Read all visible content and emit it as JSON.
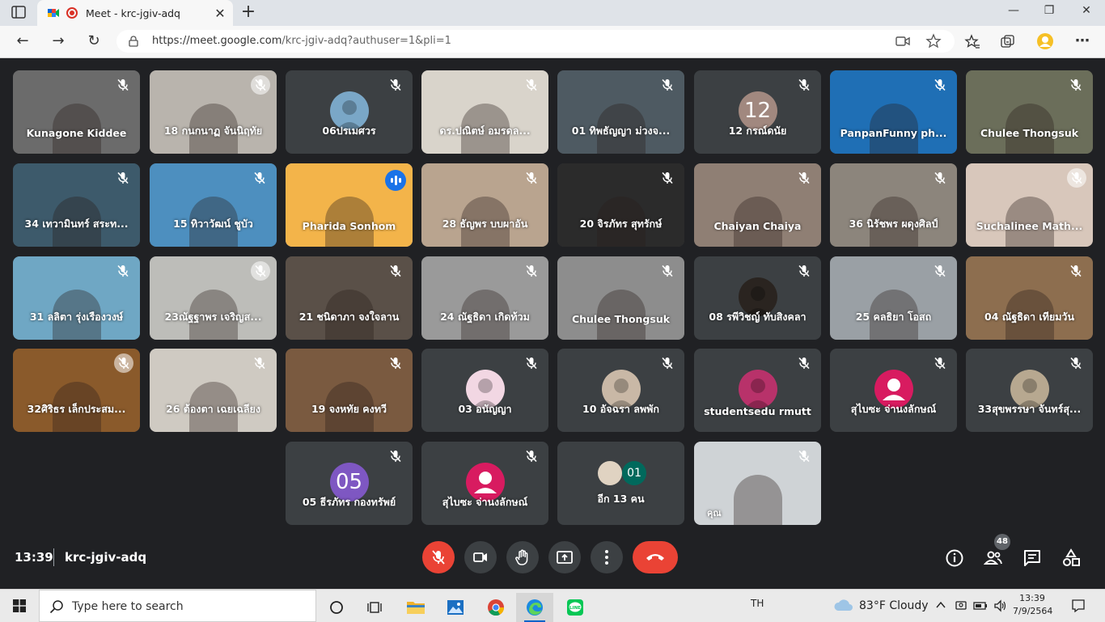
{
  "browser": {
    "tab_title": "Meet - krc-jgiv-adq",
    "url_host": "https://meet.google.com",
    "url_path": "/krc-jgiv-adq?authuser=1&pli=1"
  },
  "tiles": [
    {
      "name": "Kunagone Kiddee",
      "row": 0,
      "col": 0,
      "kind": "video",
      "bg": "#6b6b6b"
    },
    {
      "name": "18 กนกนาฏ จันนิฤทัย",
      "row": 0,
      "col": 1,
      "kind": "video",
      "bg": "#b9b4ad"
    },
    {
      "name": "06ปรเมศวร",
      "row": 0,
      "col": 2,
      "kind": "photo",
      "bg": "#3c4043",
      "avatar_color": "#7aa7c7"
    },
    {
      "name": "ดร.ปณิตษ์ อมรดล...",
      "row": 0,
      "col": 3,
      "kind": "video",
      "bg": "#d9d4cb"
    },
    {
      "name": "01 ทิพธัญญา ม่วงจ...",
      "row": 0,
      "col": 4,
      "kind": "video",
      "bg": "#4e5a62"
    },
    {
      "name": "12 กรณ์ดนัย",
      "row": 0,
      "col": 5,
      "kind": "letter",
      "letter": "12",
      "avatar_color": "#a1887f"
    },
    {
      "name": "PanpanFunny ph...",
      "row": 0,
      "col": 6,
      "kind": "video",
      "bg": "#1f6fb5"
    },
    {
      "name": "Chulee Thongsuk",
      "row": 0,
      "col": 7,
      "kind": "video",
      "bg": "#6b6e5a"
    },
    {
      "name": "34 เทวามินทร์ สระท...",
      "row": 1,
      "col": 0,
      "kind": "video",
      "bg": "#3d5a6b"
    },
    {
      "name": "15 ทิวาวัฒน์ ชูบัว",
      "row": 1,
      "col": 1,
      "kind": "video",
      "bg": "#4d8fbf"
    },
    {
      "name": "Pharida Sonhom",
      "row": 1,
      "col": 2,
      "kind": "video",
      "bg": "#f3b44a",
      "speaking": true
    },
    {
      "name": "28 ธัญพร บบผาอัน",
      "row": 1,
      "col": 3,
      "kind": "video",
      "bg": "#b9a48f"
    },
    {
      "name": "20 จิรภัทร สุทรักษ์",
      "row": 1,
      "col": 4,
      "kind": "video",
      "bg": "#2b2b2b"
    },
    {
      "name": "Chaiyan Chaiya",
      "row": 1,
      "col": 5,
      "kind": "video",
      "bg": "#8f7f74"
    },
    {
      "name": "36 นิรัชพร ผดุงศิลป์",
      "row": 1,
      "col": 6,
      "kind": "video",
      "bg": "#8c857c"
    },
    {
      "name": "Suchalinee Math...",
      "row": 1,
      "col": 7,
      "kind": "video",
      "bg": "#d8c7bb"
    },
    {
      "name": "31 ลลิตา รุ่งเรืองวงษ์",
      "row": 2,
      "col": 0,
      "kind": "video",
      "bg": "#6fa7c4"
    },
    {
      "name": "23ณัฐฐาพร เจริญส...",
      "row": 2,
      "col": 1,
      "kind": "video",
      "bg": "#bdbdb9"
    },
    {
      "name": "21 ชนิดาภา จงใจลาน",
      "row": 2,
      "col": 2,
      "kind": "video",
      "bg": "#5a5048"
    },
    {
      "name": "24 ณัฐธิดา เกิดท้วม",
      "row": 2,
      "col": 3,
      "kind": "video",
      "bg": "#9a9a9a"
    },
    {
      "name": "Chulee Thongsuk",
      "row": 2,
      "col": 4,
      "kind": "video",
      "bg": "#8d8d8d"
    },
    {
      "name": "08 รพีวิชญ์ ทับสิงคลา",
      "row": 2,
      "col": 5,
      "kind": "photo",
      "avatar_color": "#2a2420"
    },
    {
      "name": "25 คลธิยา โอสถ",
      "row": 2,
      "col": 6,
      "kind": "video",
      "bg": "#9aa0a5"
    },
    {
      "name": "04 ณัฐธิดา เทียมวัน",
      "row": 2,
      "col": 7,
      "kind": "video",
      "bg": "#8d6e4f"
    },
    {
      "name": "32ศิริธร เล็กประสม...",
      "row": 3,
      "col": 0,
      "kind": "video",
      "bg": "#8a5a2b"
    },
    {
      "name": "26 ต้องตา เฉยเฉลียง",
      "row": 3,
      "col": 1,
      "kind": "video",
      "bg": "#cfcac2"
    },
    {
      "name": "19 จงหทัย คงทวี",
      "row": 3,
      "col": 2,
      "kind": "video",
      "bg": "#7a5a40"
    },
    {
      "name": "03 อนัญญา",
      "row": 3,
      "col": 3,
      "kind": "photo",
      "avatar_color": "#f2d7e3"
    },
    {
      "name": "10 อัจฉรา ลพพัก",
      "row": 3,
      "col": 4,
      "kind": "photo",
      "avatar_color": "#c9b8a6"
    },
    {
      "name": "studentsedu rmutt",
      "row": 3,
      "col": 5,
      "kind": "photo",
      "avatar_color": "#b8326a"
    },
    {
      "name": "สุไบซะ จ่านงลักษณ์",
      "row": 3,
      "col": 6,
      "kind": "person",
      "avatar_color": "#d81b60"
    },
    {
      "name": "33สุขพรรษา จันทร์สุ...",
      "row": 3,
      "col": 7,
      "kind": "photo",
      "avatar_color": "#b7a890"
    },
    {
      "name": "05 ธีรภัทร กองทรัพย์",
      "row": 4,
      "col": 2,
      "kind": "letter",
      "letter": "05",
      "avatar_color": "#7e57c2"
    },
    {
      "name": "สุไบซะ จ่านงลักษณ์",
      "row": 4,
      "col": 3,
      "kind": "person",
      "avatar_color": "#d81b60"
    },
    {
      "name": "อีก 13 คน",
      "row": 4,
      "col": 4,
      "kind": "more",
      "letter": "01",
      "avatar_color": "#00695c"
    },
    {
      "name": "คุณ",
      "row": 4,
      "col": 5,
      "kind": "self",
      "bg": "#cfd3d6"
    }
  ],
  "meeting": {
    "time": "13:39",
    "code": "krc-jgiv-adq",
    "participant_count": "48"
  },
  "taskbar": {
    "search_placeholder": "Type here to search",
    "language": "TH",
    "weather": "83°F  Cloudy",
    "clock_time": "13:39",
    "clock_date": "7/9/2564"
  }
}
